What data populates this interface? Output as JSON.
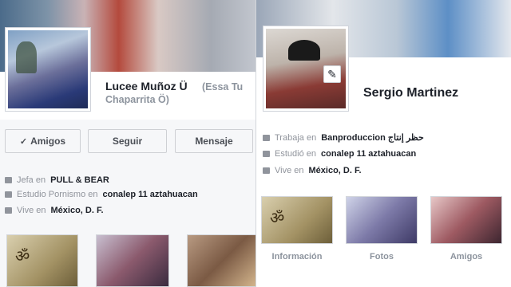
{
  "left_profile": {
    "name": "Lucee Muñoz Ü",
    "alt_name_line1": "(Essa Tu",
    "alt_name_line2": "Chaparrita Ö)",
    "buttons": {
      "friends": "Amigos",
      "follow": "Seguir",
      "message": "Mensaje"
    },
    "info": {
      "work_prefix": "Jefa en",
      "work_place": "PULL & BEAR",
      "study_prefix": "Estudio Pornismo en",
      "study_place": "conalep 11 aztahuacan",
      "live_prefix": "Vive en",
      "live_place": "México, D. F."
    },
    "thumb_glyph": "ॐ"
  },
  "right_profile": {
    "name": "Sergio Martinez",
    "info": {
      "work_prefix": "Trabaja en",
      "work_place": "Banproduccion حظر إنتاج",
      "study_prefix": "Estudió en",
      "study_place": "conalep 11 aztahuacan",
      "live_prefix": "Vive en",
      "live_place": "México, D. F."
    },
    "tiles": {
      "info": "Información",
      "photos": "Fotos",
      "friends": "Amigos"
    },
    "tile_glyph": "ॐ"
  },
  "icons": {
    "check": "check-icon",
    "edit": "pencil-icon",
    "work": "briefcase-icon",
    "study": "graduation-icon",
    "home": "home-icon"
  }
}
